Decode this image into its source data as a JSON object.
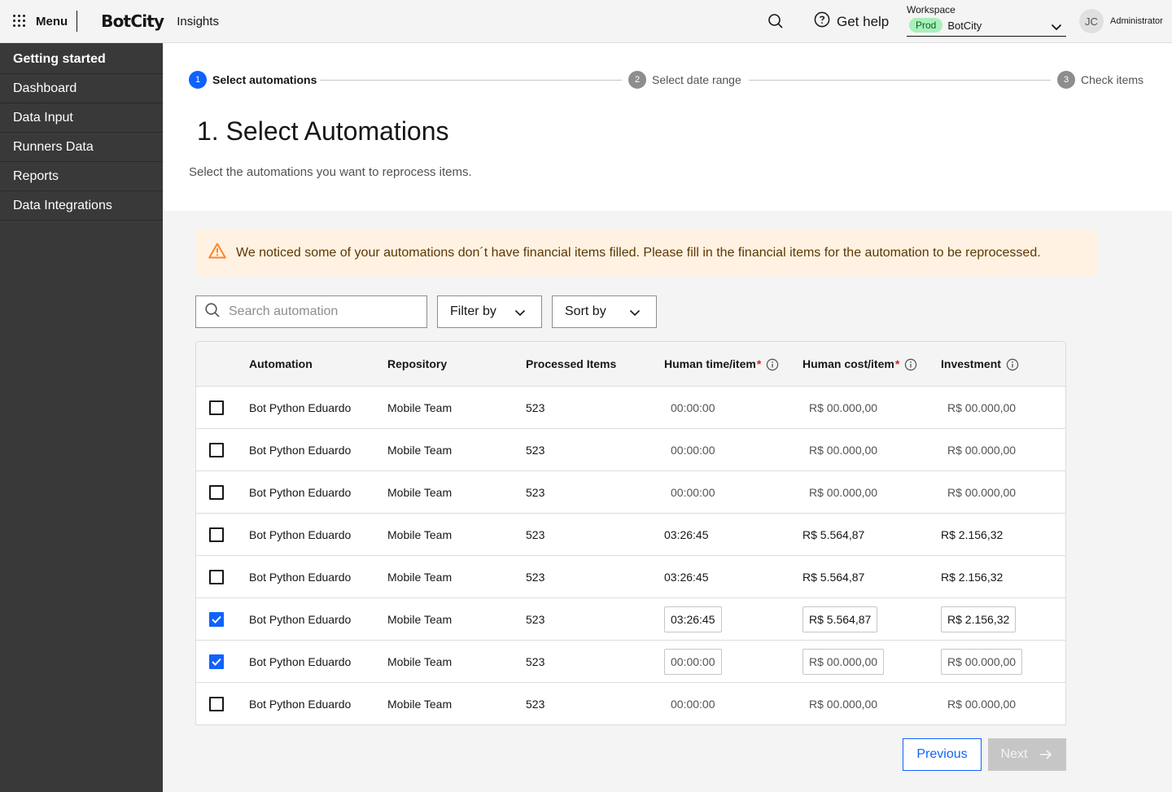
{
  "header": {
    "menu_label": "Menu",
    "logo_text": "BotCity",
    "app_name": "Insights",
    "help_label": "Get help",
    "workspace_label": "Workspace",
    "workspace_env": "Prod",
    "workspace_name": "BotCity",
    "avatar_initials": "JC",
    "user_role": "Administrator"
  },
  "sidebar": {
    "items": [
      {
        "label": "Getting started",
        "active": true
      },
      {
        "label": "Dashboard",
        "active": false
      },
      {
        "label": "Data Input",
        "active": false
      },
      {
        "label": "Runners Data",
        "active": false
      },
      {
        "label": "Reports",
        "active": false
      },
      {
        "label": "Data Integrations",
        "active": false
      }
    ]
  },
  "stepper": {
    "steps": [
      {
        "number": "1",
        "label": "Select automations",
        "state": "current"
      },
      {
        "number": "2",
        "label": "Select date range",
        "state": "pending"
      },
      {
        "number": "3",
        "label": "Check items",
        "state": "pending"
      }
    ]
  },
  "page": {
    "title": "1. Select Automations",
    "subtitle": "Select the automations you want to reprocess items."
  },
  "warning": {
    "text": "We noticed some of your automations don´t have financial items filled. Please fill in the financial items for the automation to be reprocessed.",
    "icon": "warning-triangle-icon",
    "color": "#ff832b"
  },
  "toolbar": {
    "search_placeholder": "Search automation",
    "filter_label": "Filter by",
    "sort_label": "Sort by"
  },
  "table": {
    "columns": {
      "automation": "Automation",
      "repository": "Repository",
      "processed": "Processed Items",
      "human_time": "Human time/item",
      "human_cost": "Human cost/item",
      "investment": "Investment",
      "required_mark": "*"
    },
    "rows": [
      {
        "checked": false,
        "automation": "Bot Python Eduardo",
        "repository": "Mobile Team",
        "processed": "523",
        "human_time": "00:00:00",
        "human_cost": "R$ 00.000,00",
        "investment": "R$ 00.000,00",
        "style": "empty"
      },
      {
        "checked": false,
        "automation": "Bot Python Eduardo",
        "repository": "Mobile Team",
        "processed": "523",
        "human_time": "00:00:00",
        "human_cost": "R$ 00.000,00",
        "investment": "R$ 00.000,00",
        "style": "empty"
      },
      {
        "checked": false,
        "automation": "Bot Python Eduardo",
        "repository": "Mobile Team",
        "processed": "523",
        "human_time": "00:00:00",
        "human_cost": "R$ 00.000,00",
        "investment": "R$ 00.000,00",
        "style": "empty"
      },
      {
        "checked": false,
        "automation": "Bot Python Eduardo",
        "repository": "Mobile Team",
        "processed": "523",
        "human_time": "03:26:45",
        "human_cost": "R$ 5.564,87",
        "investment": "R$ 2.156,32",
        "style": "filled"
      },
      {
        "checked": false,
        "automation": "Bot Python Eduardo",
        "repository": "Mobile Team",
        "processed": "523",
        "human_time": "03:26:45",
        "human_cost": "R$ 5.564,87",
        "investment": "R$ 2.156,32",
        "style": "filled"
      },
      {
        "checked": true,
        "automation": "Bot Python Eduardo",
        "repository": "Mobile Team",
        "processed": "523",
        "human_time": "03:26:45",
        "human_cost": "R$ 5.564,87",
        "investment": "R$ 2.156,32",
        "style": "boxed-filled"
      },
      {
        "checked": true,
        "automation": "Bot Python Eduardo",
        "repository": "Mobile Team",
        "processed": "523",
        "human_time": "00:00:00",
        "human_cost": "R$ 00.000,00",
        "investment": "R$ 00.000,00",
        "style": "boxed-empty"
      },
      {
        "checked": false,
        "automation": "Bot Python Eduardo",
        "repository": "Mobile Team",
        "processed": "523",
        "human_time": "00:00:00",
        "human_cost": "R$ 00.000,00",
        "investment": "R$ 00.000,00",
        "style": "empty"
      }
    ]
  },
  "footer": {
    "previous_label": "Previous",
    "next_label": "Next"
  },
  "colors": {
    "accent": "#0f62fe",
    "sidebar_bg": "#393939",
    "warning_bg": "#fff2e2",
    "env_badge_bg": "#a7f0ba",
    "required": "#da1e28"
  }
}
